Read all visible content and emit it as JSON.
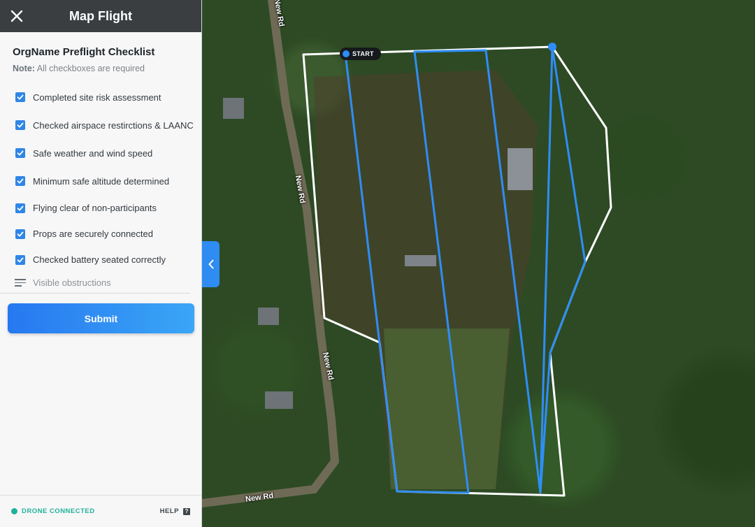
{
  "header": {
    "title": "Map Flight",
    "close_icon": "close-icon"
  },
  "checklist": {
    "title": "OrgName Preflight Checklist",
    "note_label": "Note:",
    "note_text": "All checkboxes are required",
    "items": [
      {
        "label": "Completed site risk assessment",
        "checked": true
      },
      {
        "label": "Checked airspace restirctions & LAANC",
        "checked": true
      },
      {
        "label": "Safe weather and wind speed",
        "checked": true
      },
      {
        "label": "Minimum safe altitude determined",
        "checked": true
      },
      {
        "label": "Flying clear of non-participants",
        "checked": true
      },
      {
        "label": "Props are securely connected",
        "checked": true
      },
      {
        "label": "Checked battery seated correctly",
        "checked": true
      }
    ],
    "text_item": {
      "label": "Visible obstructions",
      "icon": "text-lines-icon"
    },
    "submit_label": "Submit"
  },
  "footer": {
    "status_text": "DRONE CONNECTED",
    "help_label": "HELP",
    "help_icon_glyph": "?"
  },
  "map": {
    "start_label": "START",
    "road_labels": [
      "New Rd",
      "New Rd",
      "New Rd",
      "New Rd"
    ],
    "colors": {
      "flight_path": "#2f8df5",
      "boundary": "#ffffff",
      "accent": "#2e8cf2",
      "status": "#20b19a"
    }
  }
}
